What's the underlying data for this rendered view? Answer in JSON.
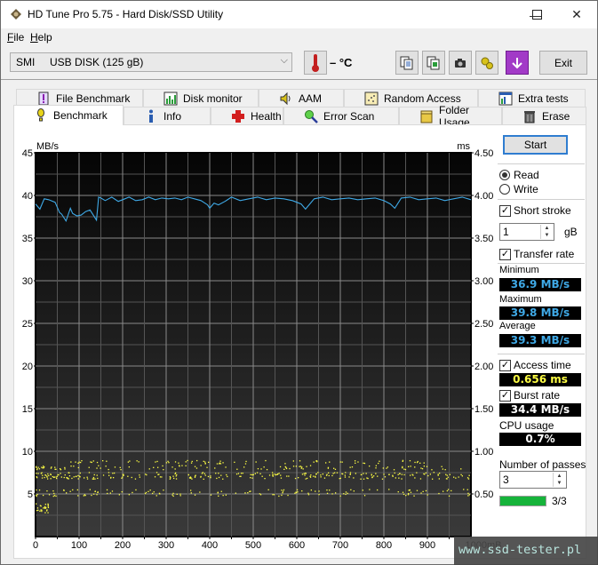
{
  "window": {
    "title": "HD Tune Pro 5.75 - Hard Disk/SSD Utility",
    "controls": {
      "minimize": "—",
      "maximize": "☐",
      "close": "✕"
    }
  },
  "menu": {
    "items": [
      {
        "label": "File",
        "accel": "F"
      },
      {
        "label": "Help",
        "accel": "H"
      }
    ]
  },
  "toolbar": {
    "drive": "SMI     USB DISK (125 gB)",
    "temperature": "– °C",
    "exit_label": "Exit",
    "icons": [
      "copy-text-icon",
      "copy-image-icon",
      "screenshot-icon",
      "options-icon",
      "save-icon"
    ]
  },
  "tabs": {
    "row_top": [
      "File Benchmark",
      "Disk monitor",
      "AAM",
      "Random Access",
      "Extra tests"
    ],
    "row_bottom": [
      "Benchmark",
      "Info",
      "Health",
      "Error Scan",
      "Folder Usage",
      "Erase"
    ],
    "active": "Benchmark"
  },
  "side": {
    "start_label": "Start",
    "read_label": "Read",
    "write_label": "Write",
    "mode": "Read",
    "short_stroke_label": "Short stroke",
    "short_stroke_checked": true,
    "short_stroke_value": "1",
    "short_stroke_unit": "gB",
    "transfer_rate_label": "Transfer rate",
    "transfer_rate_checked": true,
    "minimum_label": "Minimum",
    "minimum_value": "36.9 MB/s",
    "maximum_label": "Maximum",
    "maximum_value": "39.8 MB/s",
    "average_label": "Average",
    "average_value": "39.3 MB/s",
    "access_time_label": "Access time",
    "access_time_checked": true,
    "access_time_value": "0.656 ms",
    "burst_rate_label": "Burst rate",
    "burst_rate_checked": true,
    "burst_rate_value": "34.4 MB/s",
    "cpu_usage_label": "CPU usage",
    "cpu_usage_value": "0.7%",
    "passes_label": "Number of passes",
    "passes_value": "3",
    "progress_label": "3/3",
    "progress_fraction": 1.0,
    "colors": {
      "transfer": "#3fa9e6",
      "access": "#ffff44",
      "burst": "#ffffff",
      "progress": "#16b33a"
    }
  },
  "watermark": "www.ssd-tester.pl",
  "chart_data": {
    "type": "line",
    "title": "",
    "ylabel": "MB/s",
    "y2label": "ms",
    "xlabel": "mB",
    "xlim": [
      0,
      1000
    ],
    "ylim": [
      0,
      45
    ],
    "y2lim": [
      0,
      4.5
    ],
    "x_ticks": [
      "0",
      "100",
      "200",
      "300",
      "400",
      "500",
      "600",
      "700",
      "800",
      "900",
      "1000mB"
    ],
    "y_ticks": [
      "5",
      "10",
      "15",
      "20",
      "25",
      "30",
      "35",
      "40",
      "45"
    ],
    "y2_ticks": [
      "0.50",
      "1.00",
      "1.50",
      "2.00",
      "2.50",
      "3.00",
      "3.50",
      "4.00",
      "4.50"
    ],
    "grid": true,
    "series": [
      {
        "name": "Transfer rate",
        "axis": "left",
        "color": "#3fa9e6",
        "x": [
          0,
          10,
          20,
          30,
          45,
          55,
          60,
          70,
          80,
          85,
          95,
          105,
          115,
          125,
          140,
          145,
          150,
          160,
          175,
          190,
          200,
          215,
          230,
          245,
          260,
          275,
          290,
          305,
          320,
          335,
          350,
          365,
          380,
          395,
          400,
          410,
          420,
          435,
          450,
          470,
          490,
          510,
          530,
          550,
          570,
          590,
          600,
          610,
          620,
          640,
          660,
          680,
          700,
          720,
          740,
          760,
          780,
          800,
          815,
          825,
          840,
          860,
          880,
          900,
          920,
          940,
          960,
          980,
          1000
        ],
        "y": [
          39.0,
          38.4,
          39.6,
          39.5,
          39.2,
          38.0,
          37.8,
          37.0,
          38.5,
          37.9,
          37.6,
          37.7,
          38.1,
          38.3,
          37.1,
          39.8,
          39.7,
          39.4,
          39.8,
          39.3,
          39.5,
          39.8,
          39.4,
          39.5,
          39.8,
          39.5,
          39.7,
          39.6,
          39.7,
          39.5,
          39.8,
          39.6,
          39.4,
          38.9,
          38.5,
          39.1,
          38.9,
          39.3,
          39.8,
          39.4,
          39.6,
          39.8,
          39.5,
          39.7,
          39.6,
          39.4,
          39.2,
          39.0,
          38.4,
          39.6,
          39.8,
          39.5,
          39.6,
          39.7,
          39.5,
          39.6,
          39.7,
          39.4,
          39.0,
          38.5,
          39.7,
          39.8,
          39.5,
          39.6,
          39.7,
          39.4,
          39.6,
          39.8,
          39.5
        ]
      },
      {
        "name": "Access time",
        "axis": "right",
        "color": "#ffff44",
        "type": "scatter",
        "clusters": [
          {
            "x_range": [
              0,
              30
            ],
            "y_range": [
              0.28,
              0.4
            ],
            "count": 25
          },
          {
            "x_range": [
              0,
              1000
            ],
            "y_range": [
              0.48,
              0.56
            ],
            "count": 140
          },
          {
            "x_range": [
              0,
              1000
            ],
            "y_range": [
              0.68,
              0.76
            ],
            "count": 260
          },
          {
            "x_range": [
              0,
              1000
            ],
            "y_range": [
              0.79,
              0.84
            ],
            "count": 100
          },
          {
            "x_range": [
              80,
              900
            ],
            "y_range": [
              0.86,
              0.9
            ],
            "count": 70
          }
        ]
      }
    ]
  }
}
